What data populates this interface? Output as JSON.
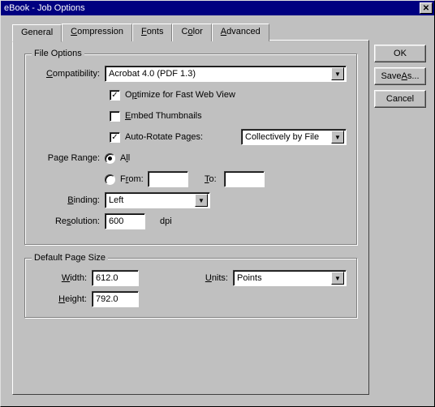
{
  "title": "eBook - Job Options",
  "tabs": [
    "General",
    "Compression",
    "Fonts",
    "Color",
    "Advanced"
  ],
  "buttons": {
    "ok": "OK",
    "saveAs": "Save As...",
    "cancel": "Cancel"
  },
  "fileOptions": {
    "legend": "File Options",
    "compatLabel": "Compatibility:",
    "compatValue": "Acrobat 4.0 (PDF 1.3)",
    "optimize": "Optimize for Fast Web View",
    "optimizeChecked": true,
    "embed": "Embed Thumbnails",
    "embedChecked": false,
    "autoRotate": "Auto-Rotate Pages:",
    "autoRotateChecked": true,
    "autoRotateValue": "Collectively by File",
    "pageRangeLabel": "Page Range:",
    "all": "All",
    "from": "From:",
    "fromValue": "",
    "to": "To:",
    "toValue": "",
    "bindingLabel": "Binding:",
    "bindingValue": "Left",
    "resolutionLabel": "Resolution:",
    "resolutionValue": "600",
    "dpi": "dpi"
  },
  "pageSize": {
    "legend": "Default Page Size",
    "widthLabel": "Width:",
    "widthValue": "612.0",
    "unitsLabel": "Units:",
    "unitsValue": "Points",
    "heightLabel": "Height:",
    "heightValue": "792.0"
  }
}
